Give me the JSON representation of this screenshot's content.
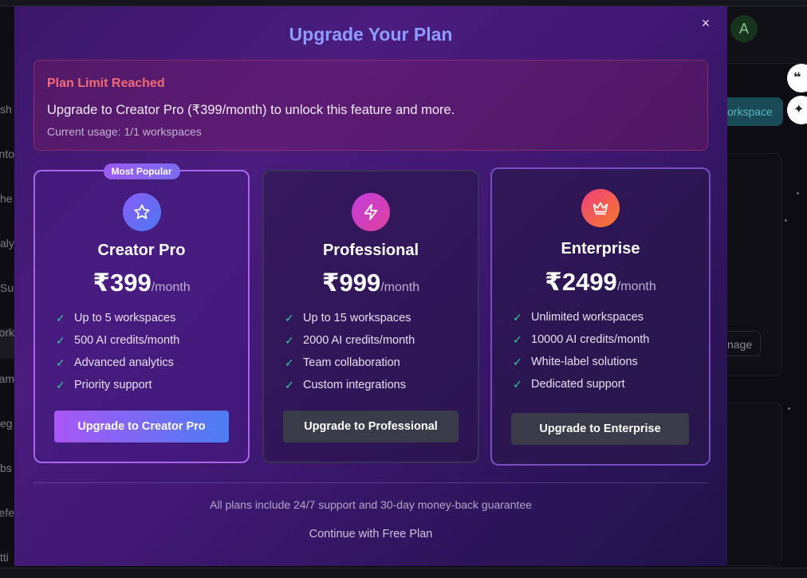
{
  "background": {
    "avatar_initial": "A",
    "sidebar_fragments": [
      "sh",
      "nto",
      "he",
      "aly",
      "Su",
      "ork",
      "am",
      "eg",
      "bs",
      "efe",
      "tti"
    ],
    "workspace_button_fragment": "orkspace",
    "manage_button_fragment": "nage"
  },
  "modal": {
    "title": "Upgrade Your Plan",
    "close_glyph": "×",
    "alert": {
      "title": "Plan Limit Reached",
      "message": "Upgrade to Creator Pro (₹399/month) to unlock this feature and more.",
      "usage": "Current usage: 1/1 workspaces"
    },
    "plans": [
      {
        "badge": "Most Popular",
        "icon": "star-icon",
        "name": "Creator Pro",
        "price": "₹399",
        "period": "/month",
        "features": [
          "Up to 5 workspaces",
          "500 AI credits/month",
          "Advanced analytics",
          "Priority support"
        ],
        "button": "Upgrade to Creator Pro"
      },
      {
        "icon": "lightning-icon",
        "name": "Professional",
        "price": "₹999",
        "period": "/month",
        "features": [
          "Up to 15 workspaces",
          "2000 AI credits/month",
          "Team collaboration",
          "Custom integrations"
        ],
        "button": "Upgrade to Professional"
      },
      {
        "icon": "crown-icon",
        "name": "Enterprise",
        "price": "₹2499",
        "period": "/month",
        "features": [
          "Unlimited workspaces",
          "10000 AI credits/month",
          "White-label solutions",
          "Dedicated support"
        ],
        "button": "Upgrade to Enterprise"
      }
    ],
    "footer_note": "All plans include 24/7 support and 30-day money-back guarantee",
    "free_plan_link": "Continue with Free Plan"
  },
  "colors": {
    "title": "#8e9bff",
    "alert_title": "#f26a78",
    "check": "#34d399",
    "primary_button_start": "#a956f5",
    "primary_button_end": "#4b7ef4",
    "muted_button": "#3a3b48"
  }
}
